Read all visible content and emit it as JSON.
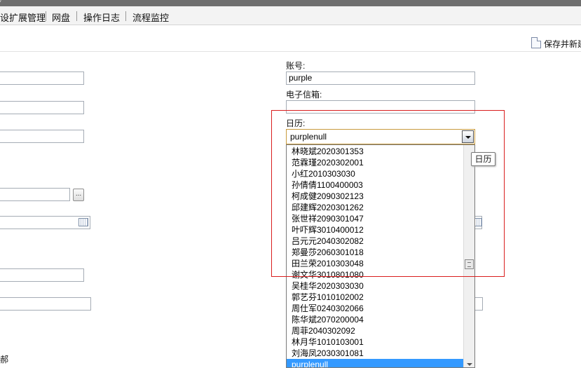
{
  "window": {
    "title_fragment": "/"
  },
  "menu": {
    "items": [
      "设扩展管理",
      "网盘",
      "操作日志",
      "流程监控"
    ]
  },
  "toolbar": {
    "save_label": "保存并新建"
  },
  "form": {
    "account_label": "账号:",
    "account_value": "purple",
    "email_label": "电子信箱:",
    "email_value": "",
    "calendar_label": "日历:",
    "calendar_selected": "purplenull",
    "calendar_options": [
      "林晓斌2020301353",
      "范霖瑾2020302001",
      "小红2010303030",
      "孙倩倩1100400003",
      "柯成健2090302123",
      "邱建辉2020301262",
      "张世祥2090301047",
      "叶吓辉3010400012",
      "吕元元2040302082",
      "郑曼莎2060301018",
      "田兰荣2010303048",
      "谢文华3010801080",
      "吴桂华2020303030",
      "郭艺芬1010102002",
      "周仕军0240302066",
      "陈华斌2070200004",
      "周菲2040302092",
      "林月华1010103001",
      "刘海凤2030301081",
      "purplenull"
    ],
    "tooltip": "日历",
    "dept_fragment": "郝",
    "stepper_label": "..."
  },
  "colors": {
    "highlight": "#d91e1e",
    "selected_option": "#3399ff",
    "select_border": "#c89a3c"
  },
  "icons": {
    "save": "document-icon",
    "calendar": "calendar-icon",
    "dropdown": "chevron-down-icon"
  }
}
